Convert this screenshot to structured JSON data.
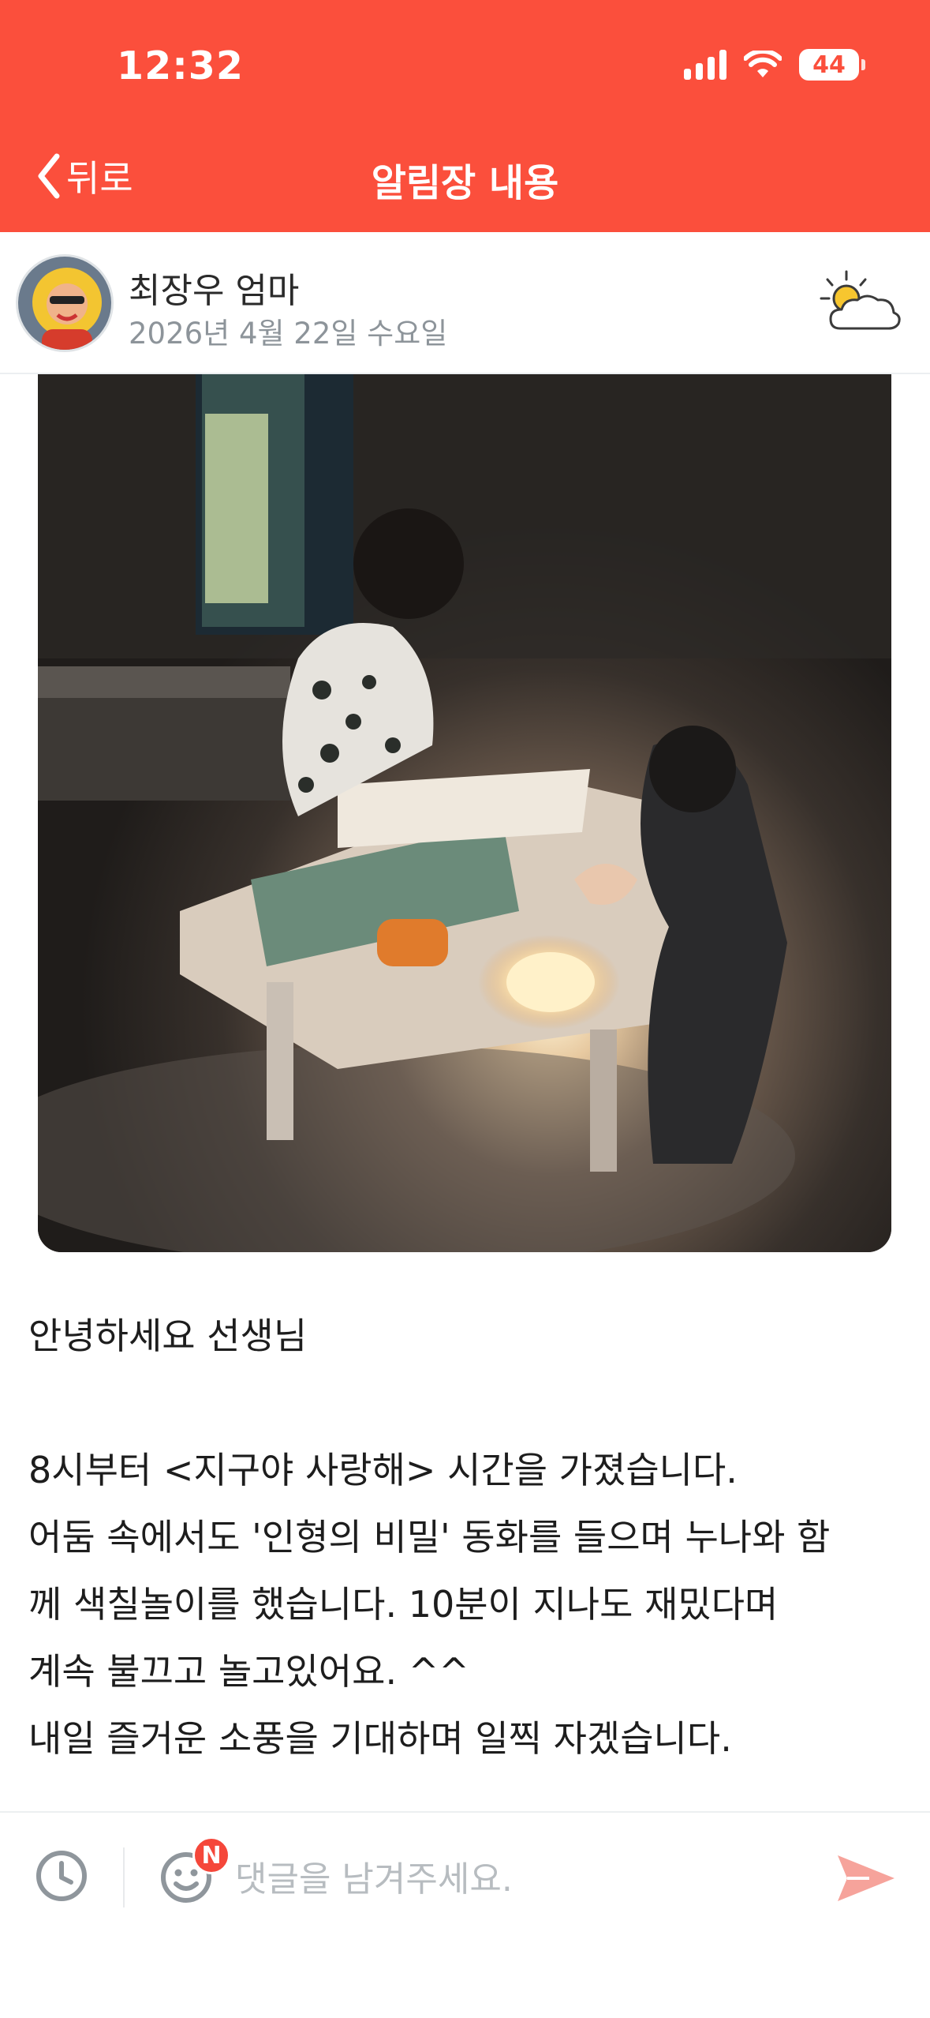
{
  "status_bar": {
    "time": "12:32",
    "battery": "44"
  },
  "nav": {
    "back_label": "뒤로",
    "title": "알림장 내용"
  },
  "post": {
    "author": "최장우 엄마",
    "date": "2026년 4월 22일 수요일",
    "weather_icon": "partly-cloudy-icon",
    "photo_description_icon": "photo"
  },
  "message": {
    "lines": [
      "안녕하세요 선생님",
      "",
      "8시부터 <지구야 사랑해> 시간을 가졌습니다.",
      "어둠 속에서도 '인형의 비밀' 동화를 들으며 누나와 함",
      "께 색칠놀이를 했습니다. 10분이 지나도 재밌다며",
      "계속 불끄고 놀고있어요. ^^",
      "내일 즐거운 소풍을 기대하며 일찍 자겠습니다."
    ]
  },
  "comment": {
    "placeholder": "댓글을 남겨주세요.",
    "badge": "N"
  },
  "colors": {
    "accent": "#fb4f3c",
    "send": "#f6a39b"
  }
}
